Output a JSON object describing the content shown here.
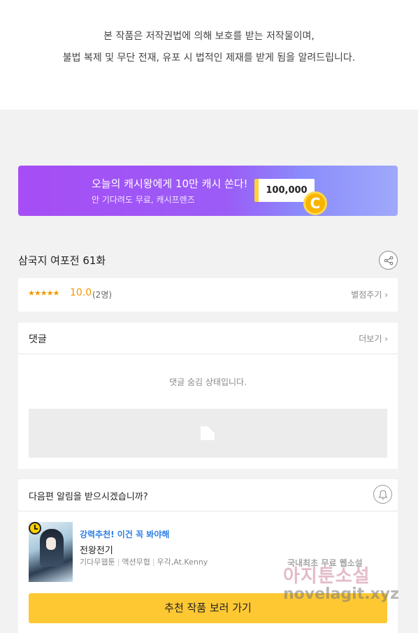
{
  "copyright": {
    "line1": "본 작품은 저작권법에 의해 보호를 받는 저작물이며,",
    "line2": "불법 복제 및 무단 전재, 유포 시 법적인 제재를 받게 됨을 알려드립니다."
  },
  "banner": {
    "title": "오늘의 캐시왕에게 10만 캐시 쏜다!",
    "subtitle": "안 기다려도 무료, 캐시프렌즈",
    "amount": "100,000",
    "coin_letter": "C"
  },
  "episode": {
    "title": "삼국지 여포전 61화",
    "share_icon": "share-icon"
  },
  "rating": {
    "stars": "★★★★★",
    "score": "10.0",
    "count": "(2명)",
    "rate_label": "별점주기 ›"
  },
  "comments": {
    "header": "댓글",
    "more_label": "더보기 ›",
    "hidden_message": "댓글 숨김 상태입니다."
  },
  "next_alert": {
    "question": "다음편 알림을 받으시겠습니까?",
    "bell_icon": "bell-icon"
  },
  "recommendation": {
    "tag": "강력추천! 이건 꼭 봐야해",
    "title": "전왕전기",
    "meta": [
      "기다무웹툰",
      "액션무협",
      "우각,At.Kenny"
    ],
    "button_label": "추천 작품 보러 가기"
  },
  "watermark": {
    "line1": "국내최초 무료 웹소설",
    "line2": "아지툰소설",
    "line3": "novelagit.xyz"
  },
  "colors": {
    "accent_yellow": "#fdc832",
    "rating_orange": "#f39800",
    "link_blue": "#2f7fe4",
    "banner_purple": "#a64df5"
  }
}
